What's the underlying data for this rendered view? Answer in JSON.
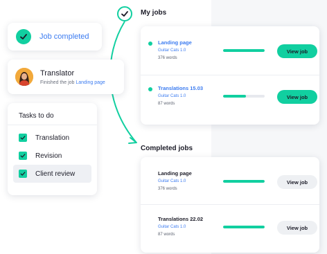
{
  "colors": {
    "accent": "#11cfa0",
    "link": "#3b7bf0",
    "text": "#1c1c28",
    "muted": "#6a6f7c"
  },
  "job_completed": {
    "label": "Job completed"
  },
  "translator": {
    "name": "Translator",
    "status_prefix": "Finished the job",
    "status_link": "Landing page"
  },
  "tasks": {
    "title": "Tasks to do",
    "items": [
      {
        "label": "Translation",
        "checked": true
      },
      {
        "label": "Revision",
        "checked": true
      },
      {
        "label": "Client review",
        "checked": true,
        "highlighted": true
      }
    ]
  },
  "my_jobs": {
    "title": "My jobs",
    "items": [
      {
        "title": "Landing page",
        "client": "Guitar Cats 1.0",
        "words": "376 words",
        "progress": 1.0,
        "button": "View job"
      },
      {
        "title": "Translations 15.03",
        "client": "Guitar Cats 1.0",
        "words": "87 words",
        "progress": 0.55,
        "button": "View job"
      }
    ]
  },
  "completed_jobs": {
    "title": "Completed jobs",
    "items": [
      {
        "title": "Landing page",
        "client": "Guitar Cats 1.0",
        "words": "376 words",
        "progress": 1.0,
        "button": "View job"
      },
      {
        "title": "Translations 22.02",
        "client": "Guitar Cats 1.0",
        "words": "87 words",
        "progress": 1.0,
        "button": "View job"
      }
    ]
  }
}
